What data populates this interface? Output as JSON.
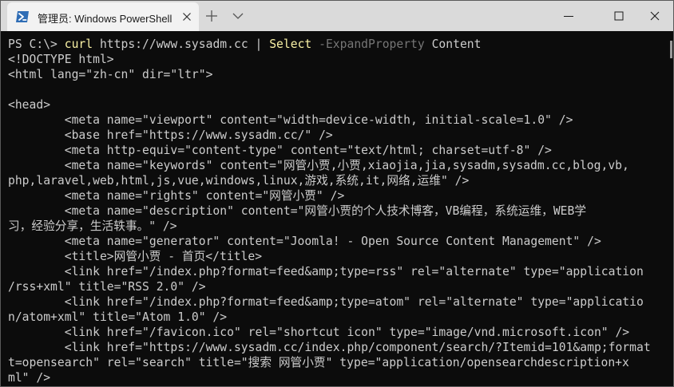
{
  "tab": {
    "title": "管理员: Windows PowerShell",
    "icon": "powershell-icon"
  },
  "colors": {
    "powershell_blue": "#012456",
    "command_yellow": "#f9f1a5",
    "parameter_gray": "#767676",
    "output_text": "#cccccc"
  },
  "terminal": {
    "prompt": "PS C:\\> ",
    "command": {
      "cmdlet": "curl",
      "url": " https://www.sysadm.cc ",
      "pipe": "| ",
      "select": "Select",
      "param": " -ExpandProperty",
      "value": " Content"
    },
    "output": [
      "<!DOCTYPE html>",
      "<html lang=\"zh-cn\" dir=\"ltr\">",
      "",
      "<head>",
      "        <meta name=\"viewport\" content=\"width=device-width, initial-scale=1.0\" />",
      "        <base href=\"https://www.sysadm.cc/\" />",
      "        <meta http-equiv=\"content-type\" content=\"text/html; charset=utf-8\" />",
      "        <meta name=\"keywords\" content=\"网管小贾,小贾,xiaojia,jia,sysadm,sysadm.cc,blog,vb,",
      "php,laravel,web,html,js,vue,windows,linux,游戏,系统,it,网络,运维\" />",
      "        <meta name=\"rights\" content=\"网管小贾\" />",
      "        <meta name=\"description\" content=\"网管小贾的个人技术博客，VB编程，系统运维，WEB学",
      "习，经验分享，生活轶事。\" />",
      "        <meta name=\"generator\" content=\"Joomla! - Open Source Content Management\" />",
      "        <title>网管小贾 - 首页</title>",
      "        <link href=\"/index.php?format=feed&amp;type=rss\" rel=\"alternate\" type=\"application",
      "/rss+xml\" title=\"RSS 2.0\" />",
      "        <link href=\"/index.php?format=feed&amp;type=atom\" rel=\"alternate\" type=\"applicatio",
      "n/atom+xml\" title=\"Atom 1.0\" />",
      "        <link href=\"/favicon.ico\" rel=\"shortcut icon\" type=\"image/vnd.microsoft.icon\" />",
      "        <link href=\"https://www.sysadm.cc/index.php/component/search/?Itemid=101&amp;format",
      "t=opensearch\" rel=\"search\" title=\"搜索 网管小贾\" type=\"application/opensearchdescription+x",
      "ml\" />"
    ]
  }
}
